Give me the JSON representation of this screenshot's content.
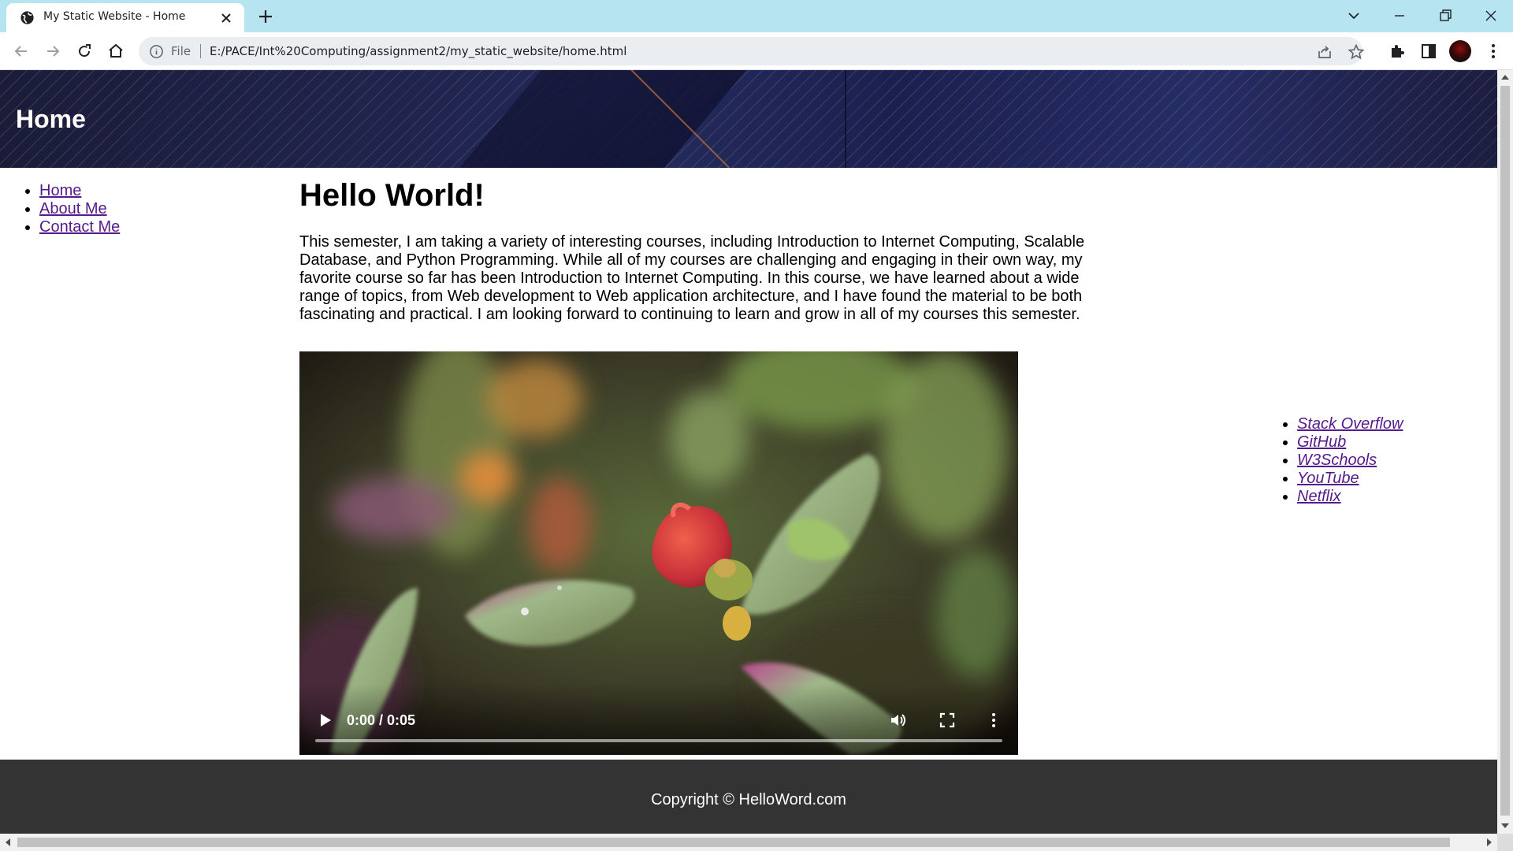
{
  "browser": {
    "tab_title": "My Static Website - Home",
    "url_scheme": "File",
    "url": "E:/PACE/Int%20Computing/assignment2/my_static_website/home.html",
    "toolbar_bg": "#b6e4f1"
  },
  "header": {
    "title": "Home"
  },
  "nav": {
    "items": [
      {
        "label": "Home"
      },
      {
        "label": "About Me"
      },
      {
        "label": "Contact Me"
      }
    ]
  },
  "main": {
    "heading": "Hello World!",
    "paragraph": "This semester, I am taking a variety of interesting courses, including Introduction to Internet Computing, Scalable Database, and Python Programming. While all of my courses are challenging and engaging in their own way, my favorite course so far has been Introduction to Internet Computing. In this course, we have learned about a wide range of topics, from Web development to Web application architecture, and I have found the material to be both fascinating and practical. I am looking forward to continuing to learn and grow in all of my courses this semester.",
    "video": {
      "time": "0:00 / 0:05",
      "progress": 0
    }
  },
  "links": {
    "items": [
      {
        "label": "Stack Overflow"
      },
      {
        "label": "GitHub"
      },
      {
        "label": "W3Schools"
      },
      {
        "label": "YouTube"
      },
      {
        "label": "Netflix"
      }
    ]
  },
  "footer": {
    "text": "Copyright © HelloWord.com"
  },
  "colors": {
    "link_visited": "#551a8b",
    "footer_bg": "#333333",
    "header_bg": "#222a5c"
  }
}
